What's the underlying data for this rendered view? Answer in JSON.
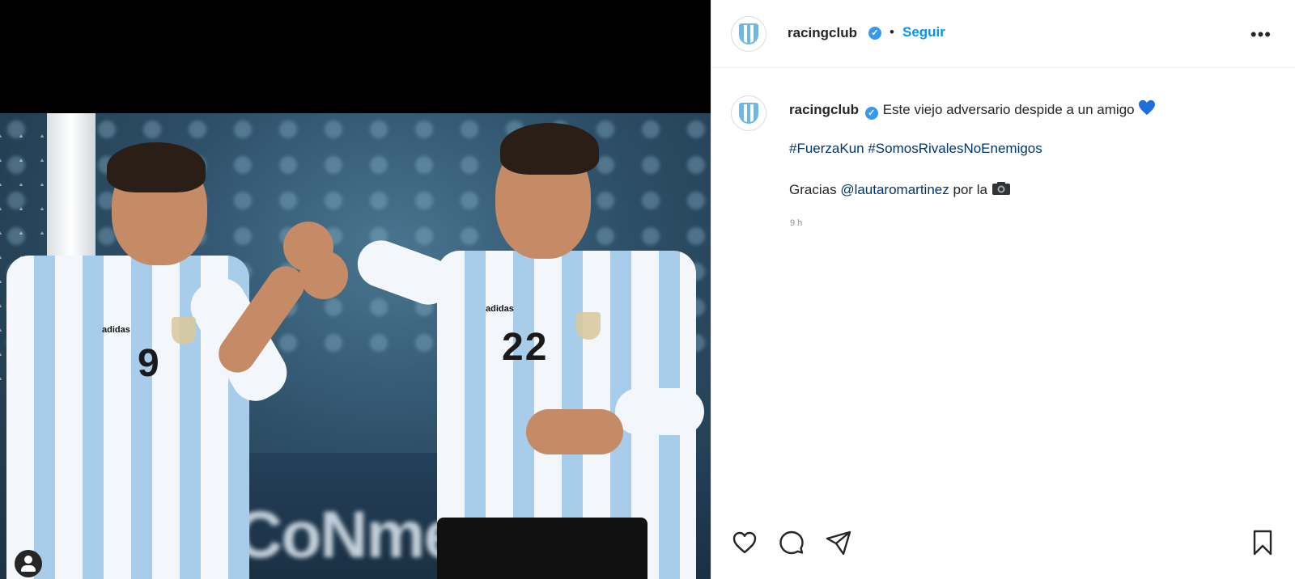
{
  "post": {
    "account": {
      "username": "racingclub",
      "verified": true,
      "follow_label": "Seguir",
      "separator": "•",
      "more_label": "•••"
    },
    "caption": {
      "username": "racingclub",
      "line1": "Este viejo adversario despide a un amigo",
      "line1_emoji": "blue-heart",
      "hashtags": "#FuerzaKun #SomosRivalesNoEnemigos",
      "line3_prefix": "Gracias",
      "mention": "@lautaromartinez",
      "line3_suffix": "por la",
      "line3_emoji": "camera",
      "timestamp": "9 h"
    },
    "image": {
      "jersey_numbers": [
        "9",
        "22"
      ],
      "brand": "adidas"
    },
    "actions": [
      "like-icon",
      "comment-icon",
      "share-icon",
      "save-icon"
    ]
  },
  "colors": {
    "accent": "#0095f6",
    "verified": "#3897f0",
    "link": "#00376b",
    "text": "#262626",
    "muted": "#8e8e8e"
  }
}
